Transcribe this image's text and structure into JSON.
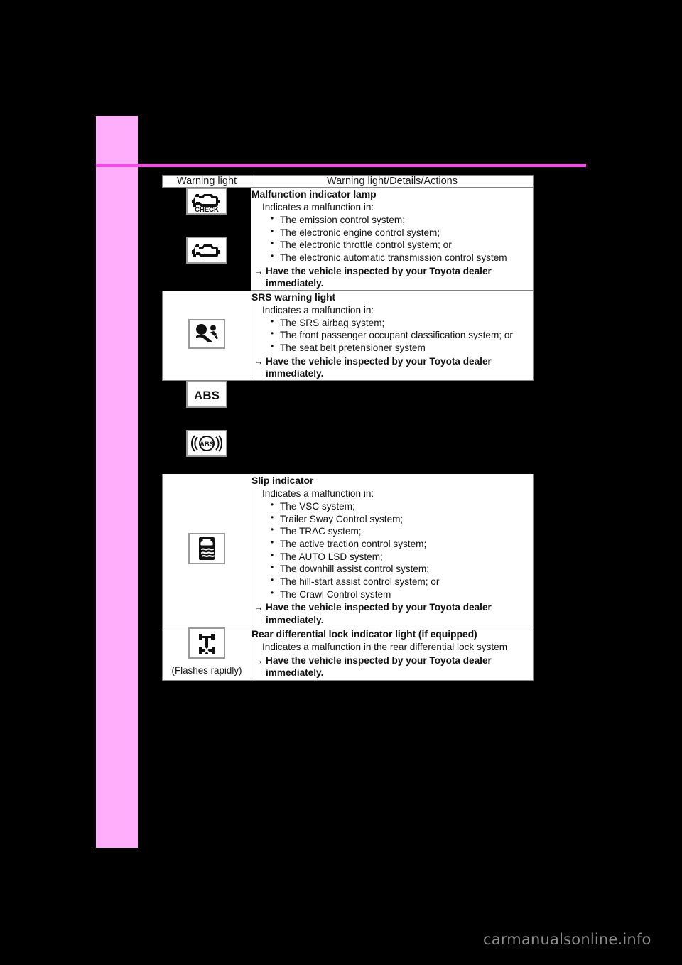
{
  "page": {
    "background_color": "#000000",
    "side_tab_color": "#FFAEFB",
    "rule_color": "#FF44F0",
    "watermark": "carmanualsonline.info"
  },
  "table": {
    "headers": {
      "col_icon": "Warning light",
      "col_text": "Warning light/Details/Actions"
    },
    "rows": [
      {
        "id": "malfunction-indicator-lamp",
        "masked_icon_cell": true,
        "icons": [
          "check-engine-check-text-icon",
          "check-engine-icon"
        ],
        "icon_caption": "",
        "title": "Malfunction indicator lamp",
        "subtitle": "Indicates a malfunction in:",
        "bullets": [
          "The emission control system;",
          "The electronic engine control system;",
          "The electronic throttle control system; or",
          "The electronic automatic transmission control system"
        ],
        "action": "Have the vehicle inspected by your Toyota dealer immediately."
      },
      {
        "id": "srs-warning-light",
        "masked_icon_cell": false,
        "icons": [
          "srs-airbag-icon"
        ],
        "icon_caption": "",
        "title": "SRS warning light",
        "subtitle": "Indicates a malfunction in:",
        "bullets": [
          "The SRS airbag system;",
          "The front passenger occupant classification system; or",
          "The seat belt pretensioner system"
        ],
        "action": "Have the vehicle inspected by your Toyota dealer immediately."
      },
      {
        "id": "abs-warning-light",
        "masked_icon_cell": true,
        "masked_text_cell": true,
        "icons": [
          "abs-text-icon",
          "abs-circle-icon"
        ],
        "icon_caption": "",
        "title": "",
        "subtitle": "",
        "bullets": [],
        "action": ""
      },
      {
        "id": "slip-indicator",
        "masked_icon_cell": false,
        "icons": [
          "slip-indicator-icon"
        ],
        "icon_caption": "",
        "title": "Slip indicator",
        "subtitle": "Indicates a malfunction in:",
        "bullets": [
          "The VSC system;",
          "Trailer Sway Control system;",
          "The TRAC system;",
          "The active traction control system;",
          "The AUTO LSD system;",
          "The downhill assist control system;",
          "The hill-start assist control system; or",
          "The Crawl Control system"
        ],
        "action": "Have the vehicle inspected by your Toyota dealer immediately."
      },
      {
        "id": "rear-differential-lock-indicator",
        "masked_icon_cell": false,
        "icons": [
          "rear-differential-lock-icon"
        ],
        "icon_caption": "(Flashes rapidly)",
        "title": "Rear differential lock indicator light (if equipped)",
        "subtitle": "Indicates a malfunction in the rear differential lock system",
        "bullets": [],
        "action": "Have the vehicle inspected by your Toyota dealer immediately."
      }
    ]
  }
}
